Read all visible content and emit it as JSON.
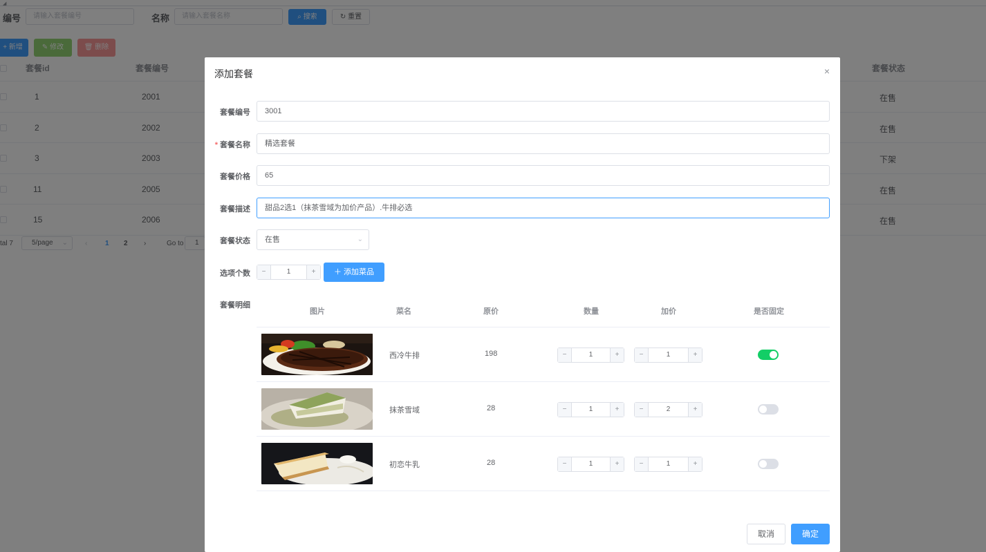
{
  "search": {
    "code_label": "编号",
    "code_placeholder": "请输入套餐编号",
    "name_label": "名称",
    "name_placeholder": "请输入套餐名称",
    "search_button": "搜索",
    "reset_button": "重置"
  },
  "toolbar": {
    "add": "新增",
    "edit": "修改",
    "delete": "删除"
  },
  "table": {
    "headers": {
      "id": "套餐id",
      "code": "套餐编号",
      "status": "套餐状态"
    },
    "rows": [
      {
        "id": "1",
        "code": "2001",
        "status": "在售"
      },
      {
        "id": "2",
        "code": "2002",
        "status": "在售"
      },
      {
        "id": "3",
        "code": "2003",
        "status": "下架"
      },
      {
        "id": "11",
        "code": "2005",
        "status": "在售"
      },
      {
        "id": "15",
        "code": "2006",
        "status": "在售"
      }
    ]
  },
  "pagination": {
    "total": "tal 7",
    "page_size": "5/page",
    "page1": "1",
    "page2": "2",
    "goto_label": "Go to",
    "goto_value": "1"
  },
  "dialog": {
    "title": "添加套餐",
    "close_symbol": "×",
    "form": {
      "code_label": "套餐编号",
      "code_value": "3001",
      "name_label": "套餐名称",
      "name_required": "*",
      "name_value": "精选套餐",
      "price_label": "套餐价格",
      "price_value": "65",
      "desc_label": "套餐描述",
      "desc_value": "甜品2选1（抹茶雪域为加价产品）.牛排必选",
      "status_label": "套餐状态",
      "status_value": "在售",
      "options_label": "选项个数",
      "options_value": "1",
      "add_dish_button": "添加菜品",
      "details_label": "套餐明细"
    },
    "detail_headers": {
      "image": "图片",
      "name": "菜名",
      "price": "原价",
      "qty": "数量",
      "extra": "加价",
      "fixed": "是否固定"
    },
    "dishes": [
      {
        "name": "西冷牛排",
        "price": "198",
        "qty": "1",
        "extra": "1",
        "fixed": true
      },
      {
        "name": "抹茶雪域",
        "price": "28",
        "qty": "1",
        "extra": "2",
        "fixed": false
      },
      {
        "name": "初恋牛乳",
        "price": "28",
        "qty": "1",
        "extra": "1",
        "fixed": false
      }
    ],
    "cancel_button": "取消",
    "confirm_button": "确定"
  },
  "colors": {
    "primary": "#409eff",
    "success": "#95d475",
    "danger": "#f89898",
    "switch_on": "#13ce66"
  }
}
